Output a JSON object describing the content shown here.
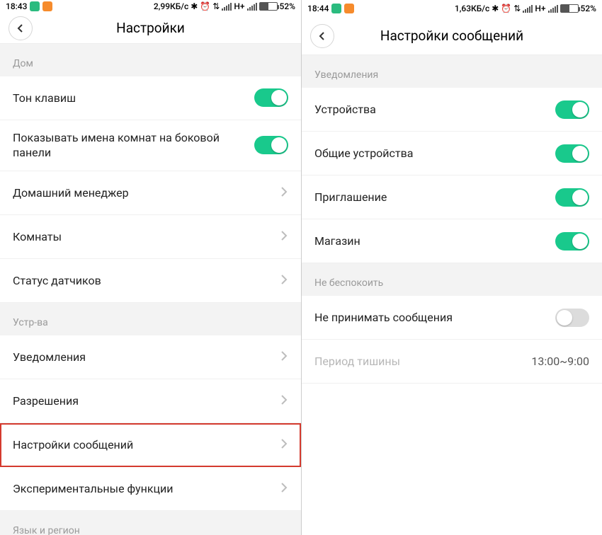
{
  "left": {
    "status": {
      "time": "18:43",
      "net": "2,99КБ/с",
      "hplus": "Н+",
      "batt": "52%"
    },
    "title": "Настройки",
    "sections": {
      "home_hdr": "Дом",
      "keytone": "Тон клавиш",
      "roomnames": "Показывать имена комнат на боковой панели",
      "home_mgr": "Домашний менеджер",
      "rooms": "Комнаты",
      "sensor_status": "Статус датчиков",
      "devices_hdr": "Устр-ва",
      "notifications": "Уведомления",
      "permissions": "Разрешения",
      "msg_settings": "Настройки сообщений",
      "experimental": "Экспериментальные функции",
      "lang_hdr": "Язык и регион"
    }
  },
  "right": {
    "status": {
      "time": "18:44",
      "net": "1,63КБ/с",
      "hplus": "Н+",
      "batt": "52%"
    },
    "title": "Настройки сообщений",
    "sections": {
      "notif_hdr": "Уведомления",
      "devices": "Устройства",
      "shared_devices": "Общие устройства",
      "invite": "Приглашение",
      "store": "Магазин",
      "dnd_hdr": "Не беспокоить",
      "no_msgs": "Не принимать сообщения",
      "quiet_period": "Период тишины",
      "quiet_value": "13:00~9:00"
    }
  }
}
